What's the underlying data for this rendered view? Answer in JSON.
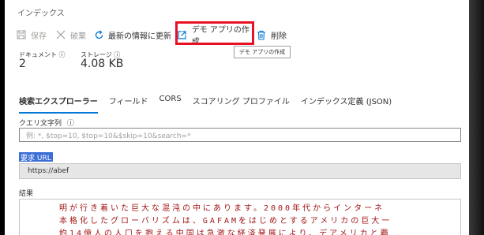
{
  "title": "インデックス",
  "toolbar": {
    "save": "保存",
    "discard": "破棄",
    "refresh": "最新の情報に更新",
    "create_demo_app": "デモ アプリの作成",
    "delete": "削除"
  },
  "tooltip": "デモ アプリの作成",
  "stats": {
    "documents_label": "ドキュメント",
    "documents_value": "2",
    "storage_label": "ストレージ",
    "storage_value": "4.08 KB"
  },
  "tabs": [
    "検索エクスプローラー",
    "フィールド",
    "CORS",
    "スコアリング プロファイル",
    "インデックス定義 (JSON)"
  ],
  "query": {
    "label": "クエリ文字列",
    "placeholder": "例: *, $top=10, $top=10&$skip=10&search=*"
  },
  "request_url": {
    "label": "要求 URL",
    "value": "https://abef"
  },
  "results": {
    "label": "結果",
    "lines": [
      "明が行き着いた巨大な混沌の中にあります。2000年代からインターネ",
      "本格化したグローバリズムは、GAFAMをはじめとするアメリカの巨大一",
      "約14億人の人口を抱える中国は急激な経済発展により、デアメリカと覇"
    ]
  },
  "colors": {
    "accent": "#0078d4",
    "highlight_border": "#e81123",
    "result_text": "#a31515",
    "selection": "#3b6fd6"
  }
}
